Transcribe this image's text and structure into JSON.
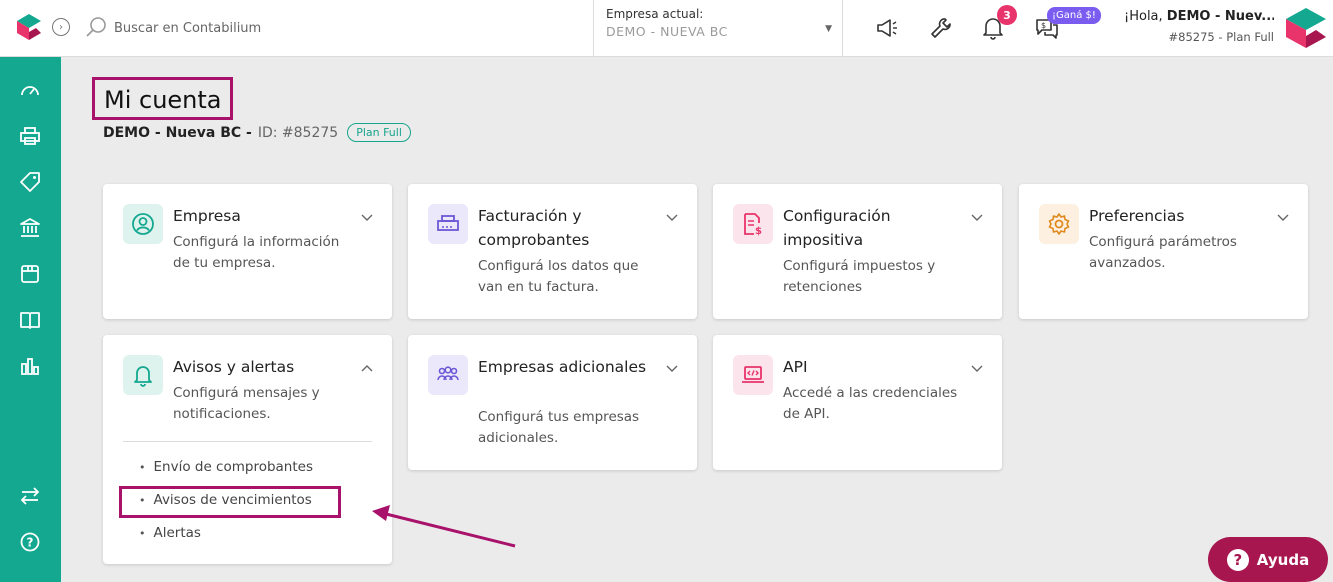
{
  "header": {
    "search_placeholder": "Buscar en Contabilium",
    "company_label": "Empresa actual:",
    "company_value": "DEMO - NUEVA BC",
    "notifications_count": "3",
    "gana_badge": "¡Ganá $!",
    "greeting_prefix": "¡Hola, ",
    "greeting_name": "DEMO - Nuev...",
    "account_id": "#85275 - Plan Full"
  },
  "page": {
    "title": "Mi cuenta",
    "company": "DEMO - Nueva BC -",
    "id_text": "ID: #85275",
    "plan": "Plan Full"
  },
  "cards": {
    "empresa": {
      "title": "Empresa",
      "desc": "Configurá la información de tu empresa."
    },
    "facturacion": {
      "title": "Facturación y comprobantes",
      "desc": "Configurá los datos que van en tu factura."
    },
    "impositiva": {
      "title": "Configuración impositiva",
      "desc": "Configurá impuestos y retenciones"
    },
    "preferencias": {
      "title": "Preferencias",
      "desc": "Configurá parámetros avanzados."
    },
    "avisos": {
      "title": "Avisos y alertas",
      "desc": "Configurá mensajes y notificaciones.",
      "items": [
        "Envío de comprobantes",
        "Avisos de vencimientos",
        "Alertas"
      ]
    },
    "adicionales": {
      "title": "Empresas adicionales",
      "desc": "Configurá tus empresas adicionales."
    },
    "api": {
      "title": "API",
      "desc": "Accedé a las credenciales de API."
    }
  },
  "help": {
    "label": "Ayuda"
  },
  "colors": {
    "sidebar": "#13a88f",
    "accent": "#a8126a",
    "badge": "#e8336b"
  },
  "icons": {
    "sidebar": [
      "dashboard-icon",
      "printer-icon",
      "tag-icon",
      "bank-icon",
      "box-icon",
      "book-icon",
      "chart-icon",
      "transfer-icon",
      "help-circle-icon"
    ],
    "topbar": [
      "search-icon",
      "megaphone-icon",
      "wrench-icon",
      "bell-icon",
      "chat-dollar-icon"
    ]
  }
}
